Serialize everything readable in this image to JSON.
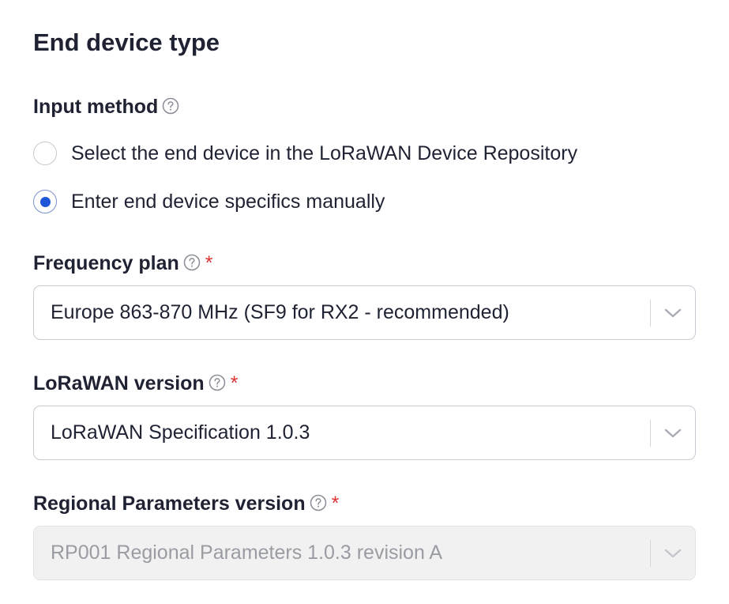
{
  "section": {
    "title": "End device type"
  },
  "input_method": {
    "label": "Input method",
    "options": [
      {
        "label": "Select the end device in the LoRaWAN Device Repository",
        "checked": false
      },
      {
        "label": "Enter end device specifics manually",
        "checked": true
      }
    ]
  },
  "frequency_plan": {
    "label": "Frequency plan",
    "required_mark": "*",
    "value": "Europe 863-870 MHz (SF9 for RX2 - recommended)",
    "disabled": false
  },
  "lorawan_version": {
    "label": "LoRaWAN version",
    "required_mark": "*",
    "value": "LoRaWAN Specification 1.0.3",
    "disabled": false
  },
  "regional_parameters_version": {
    "label": "Regional Parameters version",
    "required_mark": "*",
    "value": "RP001 Regional Parameters 1.0.3 revision A",
    "disabled": true
  },
  "icons": {
    "help": "question-circle-icon",
    "dropdown": "chevron-down-icon"
  },
  "colors": {
    "text": "#1f2232",
    "required": "#dd3333",
    "radio_selected": "#1f56d8",
    "border": "#c8cbd3",
    "disabled_bg": "#f1f1f1",
    "disabled_text": "#9a9ca3"
  }
}
